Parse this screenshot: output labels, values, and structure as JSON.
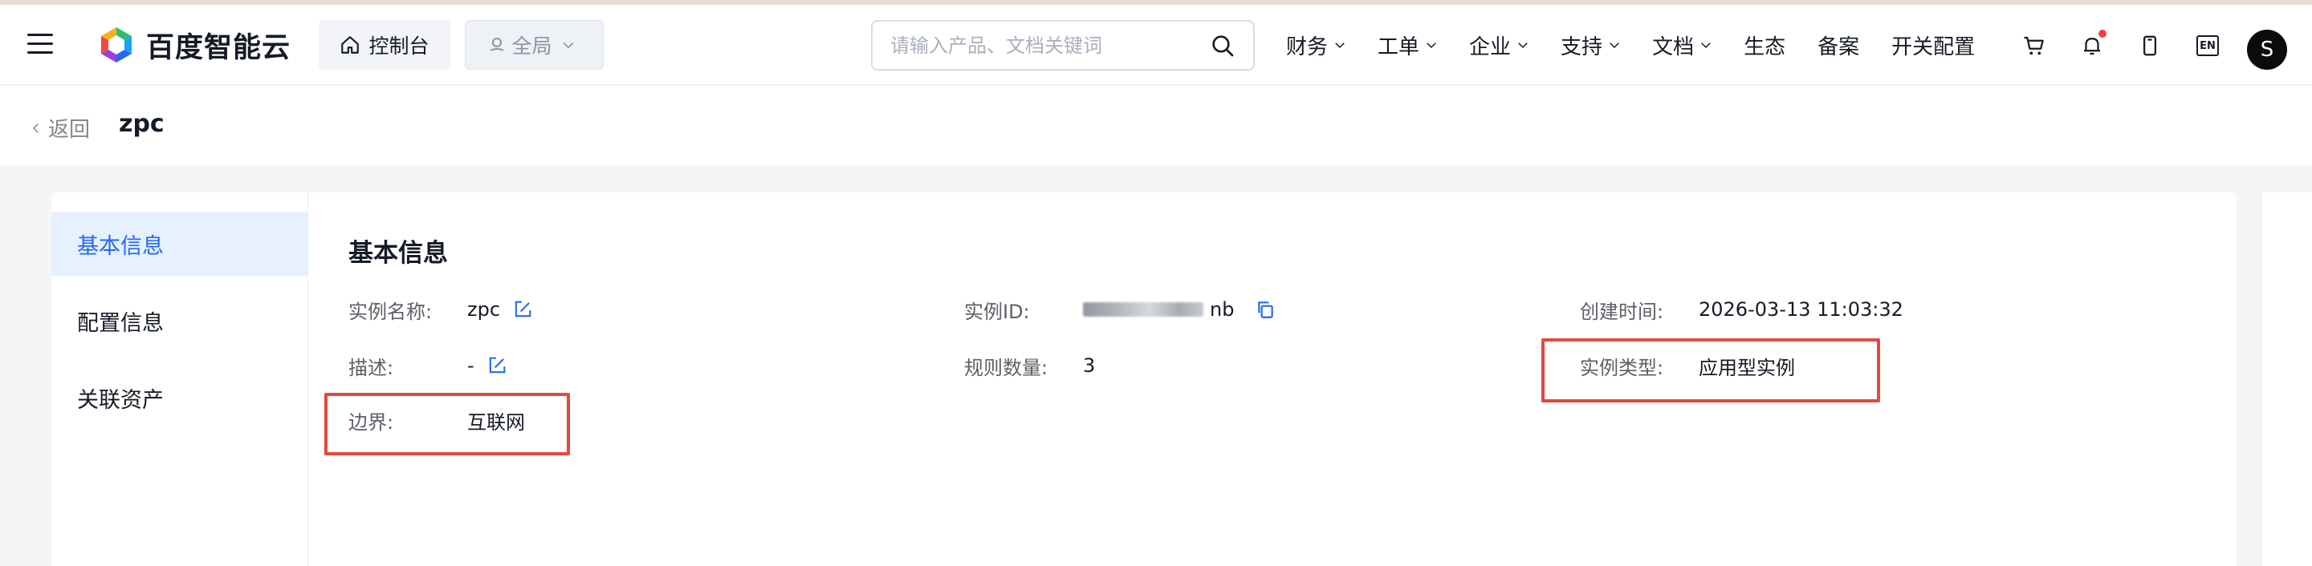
{
  "header": {
    "brand": "百度智能云",
    "console_label": "控制台",
    "region_label": "全局",
    "search_placeholder": "请输入产品、文档关键词",
    "nav": [
      {
        "label": "财务",
        "dropdown": true
      },
      {
        "label": "工单",
        "dropdown": true
      },
      {
        "label": "企业",
        "dropdown": true
      },
      {
        "label": "支持",
        "dropdown": true
      },
      {
        "label": "文档",
        "dropdown": true
      },
      {
        "label": "生态",
        "dropdown": false
      },
      {
        "label": "备案",
        "dropdown": false
      },
      {
        "label": "开关配置",
        "dropdown": false
      }
    ],
    "lang_label": "EN",
    "avatar_letter": "S"
  },
  "breadcrumb": {
    "back_label": "返回",
    "title": "zpc"
  },
  "sidebar": {
    "items": [
      {
        "label": "基本信息",
        "active": true
      },
      {
        "label": "配置信息",
        "active": false
      },
      {
        "label": "关联资产",
        "active": false
      }
    ]
  },
  "basic_info": {
    "title": "基本信息",
    "instance_name_label": "实例名称:",
    "instance_name": "zpc",
    "instance_id_label": "实例ID:",
    "instance_id_tail": "nb",
    "created_label": "创建时间:",
    "created_value": "2026-03-13 11:03:32",
    "desc_label": "描述:",
    "desc_value": "-",
    "rule_count_label": "规则数量:",
    "rule_count_value": "3",
    "instance_type_label": "实例类型:",
    "instance_type_value": "应用型实例",
    "boundary_label": "边界:",
    "boundary_value": "互联网"
  },
  "colors": {
    "accent": "#2468f2",
    "highlight_box": "#e3493e",
    "notification_dot": "#f5433b"
  }
}
